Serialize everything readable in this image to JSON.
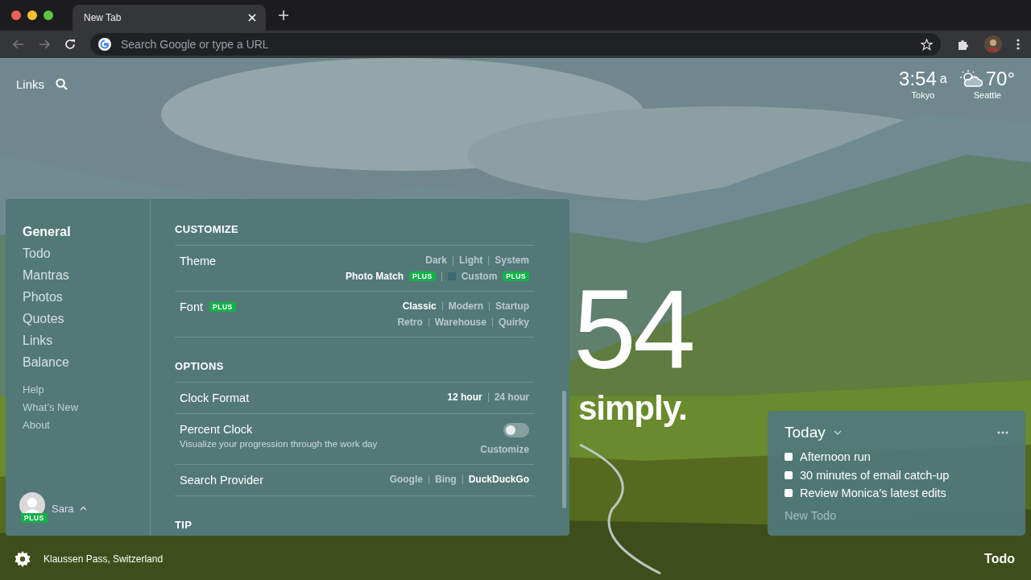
{
  "browser": {
    "tab_title": "New Tab",
    "address_placeholder": "Search Google or type a URL"
  },
  "top_left": {
    "links_label": "Links"
  },
  "clock_widget": {
    "time": "3:54",
    "ampm": "a",
    "city": "Tokyo"
  },
  "weather": {
    "temperature": "70°",
    "city": "Seattle"
  },
  "center": {
    "clock": "54",
    "mantra": "simply."
  },
  "settings": {
    "nav": [
      {
        "label": "General",
        "selected": true
      },
      {
        "label": "Todo",
        "selected": false
      },
      {
        "label": "Mantras",
        "selected": false
      },
      {
        "label": "Photos",
        "selected": false
      },
      {
        "label": "Quotes",
        "selected": false
      },
      {
        "label": "Links",
        "selected": false
      },
      {
        "label": "Balance",
        "selected": false
      }
    ],
    "secondary_nav": [
      "Help",
      "What’s New",
      "About"
    ],
    "user": {
      "name": "Sara",
      "badge": "PLUS"
    },
    "sections": [
      {
        "heading": "CUSTOMIZE",
        "rows": [
          {
            "kind": "choices",
            "label": "Theme",
            "lines": [
              [
                {
                  "label": "Dark",
                  "selected": false
                },
                {
                  "label": "Light",
                  "selected": false
                },
                {
                  "label": "System",
                  "selected": false
                }
              ],
              [
                {
                  "label": "Photo Match",
                  "selected": true,
                  "badge": "PLUS"
                },
                {
                  "label": "Custom",
                  "selected": false,
                  "checkbox": false,
                  "badge": "PLUS"
                }
              ]
            ]
          },
          {
            "kind": "choices",
            "label": "Font",
            "badge": "PLUS",
            "lines": [
              [
                {
                  "label": "Classic",
                  "selected": true
                },
                {
                  "label": "Modern",
                  "selected": false
                },
                {
                  "label": "Startup",
                  "selected": false
                }
              ],
              [
                {
                  "label": "Retro",
                  "selected": false
                },
                {
                  "label": "Warehouse",
                  "selected": false
                },
                {
                  "label": "Quirky",
                  "selected": false
                }
              ]
            ]
          }
        ]
      },
      {
        "heading": "OPTIONS",
        "rows": [
          {
            "kind": "choices",
            "label": "Clock Format",
            "lines": [
              [
                {
                  "label": "12 hour",
                  "selected": true
                },
                {
                  "label": "24 hour",
                  "selected": false
                }
              ]
            ]
          },
          {
            "kind": "toggle",
            "label": "Percent Clock",
            "description": "Visualize your progression through the work day",
            "on": false,
            "action": "Customize"
          },
          {
            "kind": "choices",
            "label": "Search Provider",
            "lines": [
              [
                {
                  "label": "Google",
                  "selected": false
                },
                {
                  "label": "Bing",
                  "selected": false
                },
                {
                  "label": "DuckDuckGo",
                  "selected": true
                }
              ]
            ]
          }
        ]
      },
      {
        "heading": "TIP"
      }
    ]
  },
  "todo": {
    "list_name": "Today",
    "items": [
      {
        "text": "Afternoon run",
        "checked": false
      },
      {
        "text": "30 minutes of email catch-up",
        "checked": false
      },
      {
        "text": "Review Monica’s latest edits",
        "checked": false
      }
    ],
    "placeholder": "New Todo"
  },
  "bottom_bar": {
    "location": "Klaussen Pass, Switzerland",
    "todo_label": "Todo"
  }
}
